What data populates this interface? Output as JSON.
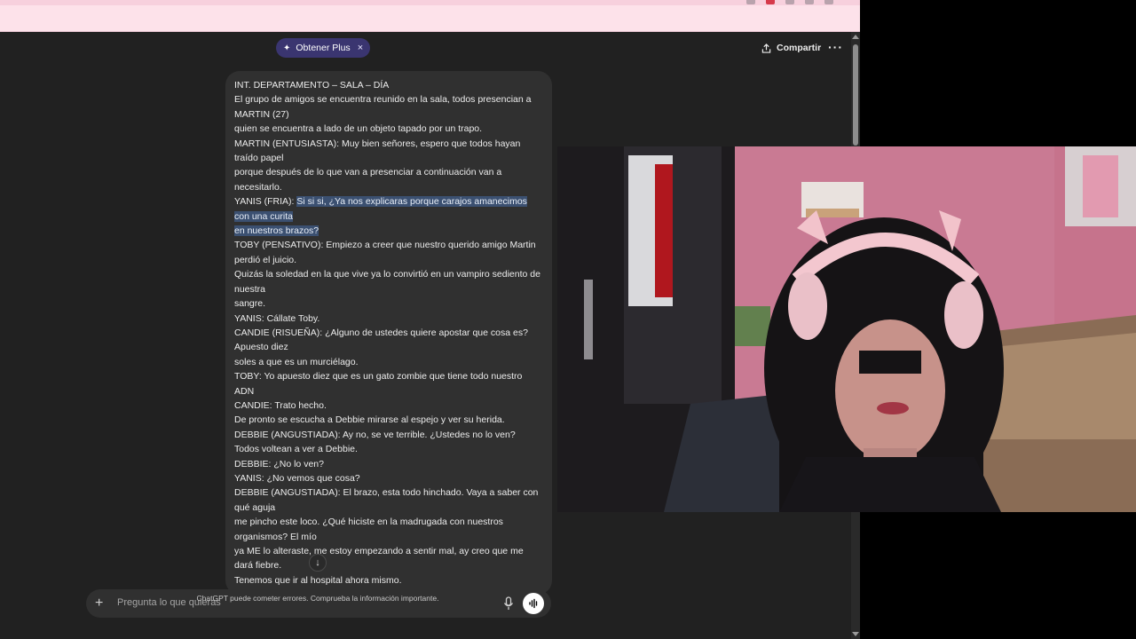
{
  "header": {
    "plus_pill": "Obtener Plus",
    "share_label": "Compartir"
  },
  "message": {
    "lines_before": [
      "INT. DEPARTAMENTO – SALA – DÍA",
      "El grupo de amigos se encuentra reunido en la sala, todos presencian a MARTIN (27)",
      "quien se encuentra a lado de un objeto tapado por un trapo.",
      "MARTIN (ENTUSIASTA): Muy bien señores, espero que todos hayan traído papel",
      "porque después de lo que van a presenciar a continuación van a necesitarlo."
    ],
    "yanis_prefix": "YANIS (FRIA): ",
    "yanis_highlight_1": "Si si si, ¿Ya nos explicaras porque carajos amanecimos con una curita",
    "yanis_highlight_2": "en nuestros brazos?",
    "lines_after": [
      "TOBY (PENSATIVO): Empiezo a creer que nuestro querido amigo Martin perdió el juicio.",
      "Quizás la soledad en la que vive ya lo convirtió en un vampiro sediento de nuestra",
      "sangre.",
      "YANIS: Cállate Toby.",
      "CANDIE (RISUEÑA): ¿Alguno de ustedes quiere apostar que cosa es? Apuesto diez",
      "soles a que es un murciélago.",
      "TOBY: Yo apuesto diez que es un gato zombie que tiene todo nuestro ADN",
      "CANDIE: Trato hecho.",
      "De pronto se escucha a Debbie mirarse al espejo y ver su herida.",
      "DEBBIE (ANGUSTIADA): Ay no, se ve terrible. ¿Ustedes no lo ven?",
      "Todos voltean a ver a Debbie.",
      "DEBBIE: ¿No lo ven?",
      "YANIS: ¿No vemos que cosa?",
      "DEBBIE (ANGUSTIADA): El brazo, esta todo hinchado. Vaya a saber con qué aguja",
      "me pincho este loco. ¿Qué hiciste en la madrugada con nuestros organismos? El mío",
      "ya ME lo alteraste, me estoy empezando a sentir mal, ay creo que me dará fiebre.",
      "Tenemos que ir al hospital ahora mismo."
    ]
  },
  "composer": {
    "placeholder": "Pregunta lo que quieras"
  },
  "footer": {
    "disclaimer": "ChatGPT puede cometer errores. Comprueba la información importante."
  },
  "colors": {
    "background": "#212121",
    "bubble": "#303030",
    "highlight": "#3b5071",
    "plus_pill": "#3a3570",
    "browser_bar": "#fde2ea"
  },
  "icons": {
    "share": "share-icon",
    "more": "more-options-icon",
    "plus": "plus-icon",
    "mic": "microphone-icon",
    "voice": "voice-mode-icon",
    "scroll": "arrow-down-icon"
  }
}
